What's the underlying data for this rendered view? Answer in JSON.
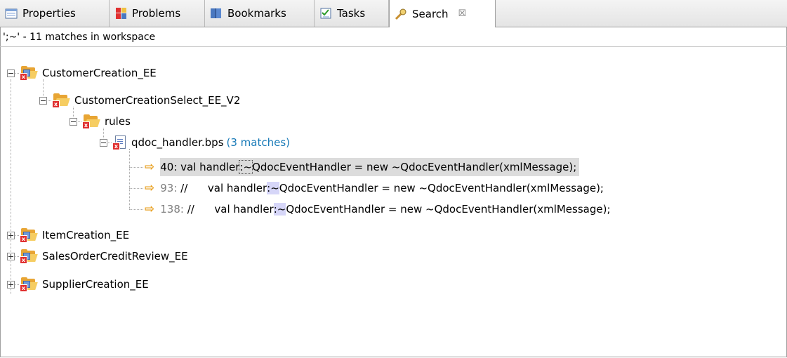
{
  "tabs": [
    {
      "label": "Properties",
      "icon": "properties-icon"
    },
    {
      "label": "Problems",
      "icon": "problems-icon"
    },
    {
      "label": "Bookmarks",
      "icon": "bookmarks-icon"
    },
    {
      "label": "Tasks",
      "icon": "tasks-icon"
    },
    {
      "label": "Search",
      "icon": "search-icon",
      "active": true,
      "close": "☒"
    }
  ],
  "status": "';~' - 11 matches in workspace",
  "tree": {
    "root1": "CustomerCreation_EE",
    "child1": "CustomerCreationSelect_EE_V2",
    "folder": "rules",
    "file": "qdoc_handler.bps",
    "file_matches": "(3 matches)",
    "matches": [
      {
        "line": "40:",
        "pre": " val handler",
        "hl": ":~",
        "post": "QdocEventHandler = new ~QdocEventHandler(xmlMessage);"
      },
      {
        "line": "93:",
        "pre": " //      val handler",
        "hl": ":~",
        "post": "QdocEventHandler = new ~QdocEventHandler(xmlMessage);"
      },
      {
        "line": "138:",
        "pre": " //      val handler",
        "hl": ":~",
        "post": "QdocEventHandler = new ~QdocEventHandler(xmlMessage);"
      }
    ],
    "root2": "ItemCreation_EE",
    "root3": "SalesOrderCreditReview_EE",
    "root4": "SupplierCreation_EE"
  },
  "colors": {
    "match_count": "#1a7bb8",
    "match_highlight": "#d6d6f8",
    "arrow": "#e8a020",
    "selection": "#dcdcdc"
  }
}
